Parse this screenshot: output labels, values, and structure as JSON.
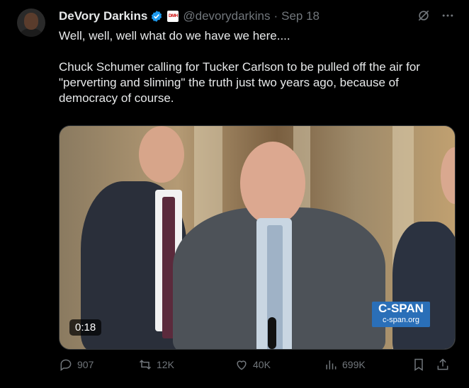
{
  "author": {
    "name": "DeVory Darkins",
    "handle": "@devorydarkins",
    "date": "Sep 18",
    "badge_text": "DMH"
  },
  "tweet_text": "Well, well, well what do we have we here....\n\nChuck Schumer calling for Tucker Carlson to be pulled off the air for \"perverting and sliming\" the truth just two years ago, because of democracy of course.",
  "video": {
    "duration": "0:18",
    "network_logo": "C-SPAN",
    "network_url": "c-span.org"
  },
  "actions": {
    "replies": "907",
    "reposts": "12K",
    "likes": "40K",
    "views": "699K"
  },
  "colors": {
    "background": "#000000",
    "text": "#e7e9ea",
    "muted": "#71767b",
    "verified": "#1d9bf0",
    "cspan": "#2a6fb8"
  },
  "icons": [
    "grok-icon",
    "more-icon",
    "verified-icon",
    "reply-icon",
    "repost-icon",
    "like-icon",
    "views-icon",
    "bookmark-icon",
    "share-icon"
  ]
}
